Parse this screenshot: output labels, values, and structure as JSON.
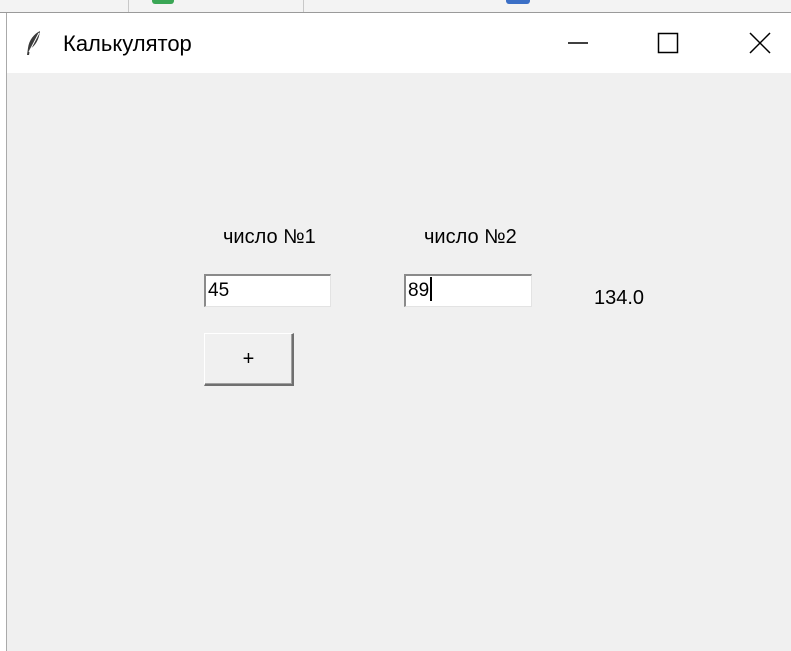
{
  "window": {
    "title": "Калькулятор",
    "icon": "feather-icon",
    "controls": {
      "minimize": "minimize-icon",
      "maximize": "maximize-icon",
      "close": "close-icon"
    }
  },
  "form": {
    "label1": "число №1",
    "label2": "число №2",
    "input1_value": "45",
    "input2_value": "89",
    "add_button_label": "+",
    "result_text": "134.0"
  },
  "colors": {
    "window_bg": "#f0f0f0",
    "titlebar_bg": "#ffffff",
    "input_bg": "#ffffff"
  }
}
